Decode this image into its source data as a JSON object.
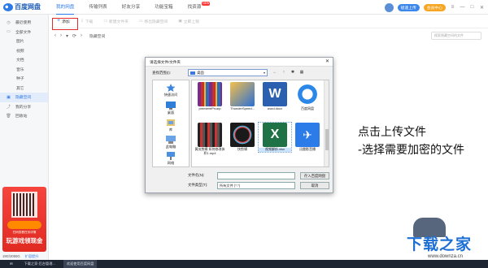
{
  "app": {
    "name": "百度网盘"
  },
  "nav": [
    "我的网盘",
    "传输列表",
    "好友分享",
    "功能宝箱",
    "找资源"
  ],
  "nav_badge": "NEW",
  "top_right": {
    "upload_label": "极速上传",
    "vip_label": "会员中心"
  },
  "sidebar": [
    {
      "label": "最近使用",
      "icon": "clock-icon"
    },
    {
      "label": "全部文件",
      "icon": "folder-icon"
    },
    {
      "label": "图片",
      "sub": true
    },
    {
      "label": "视频",
      "sub": true
    },
    {
      "label": "文档",
      "sub": true
    },
    {
      "label": "音乐",
      "sub": true
    },
    {
      "label": "种子",
      "sub": true
    },
    {
      "label": "其它",
      "sub": true
    },
    {
      "label": "隐藏空间",
      "icon": "lock-icon",
      "active": true
    },
    {
      "label": "我的分享",
      "icon": "share-icon"
    },
    {
      "label": "回收站",
      "icon": "trash-icon"
    }
  ],
  "ad": {
    "subtitle": "扫码查看任务详情",
    "title": "玩游戏领现金"
  },
  "quota": {
    "text": "19G/2055G",
    "expand": "扩容提升"
  },
  "toolbar": {
    "add": "添加",
    "download": "下载",
    "new_folder": "新建文件夹",
    "remove": "移出隐藏空间",
    "lock": "立即上锁"
  },
  "path": {
    "current": "隐藏空间",
    "search_placeholder": "搜索隐藏空间的文件"
  },
  "dialog": {
    "title": "请选择文件/文件夹",
    "look_in_label": "查找范围(I):",
    "look_in_value": "桌面",
    "places": [
      {
        "label": "快速访问",
        "icon": "star-icon"
      },
      {
        "label": "桌面",
        "icon": "desktop-icon"
      },
      {
        "label": "库",
        "icon": "library-icon"
      },
      {
        "label": "此电脑",
        "icon": "computer-icon"
      },
      {
        "label": "网络",
        "icon": "network-icon"
      }
    ],
    "files": [
      {
        "name": "premiereProzip",
        "kind": "rar"
      },
      {
        "name": "ThunderSpeed...",
        "kind": "thunder"
      },
      {
        "name": "word.docx",
        "kind": "word"
      },
      {
        "name": "百度网盘",
        "kind": "baidu"
      },
      {
        "name": "黄瓜剪辑 如何修改体积1.mp4",
        "kind": "video"
      },
      {
        "name": "快剪辑",
        "kind": "kuaijian"
      },
      {
        "name": "视频解析.xlsx",
        "kind": "excel",
        "selected": true
      },
      {
        "name": "迅雷影音播",
        "kind": "xunlei"
      }
    ],
    "filename_label": "文件名(N):",
    "filename_value": "",
    "filetype_label": "文件类型(T):",
    "filetype_value": "所有文件 (*.*)",
    "save_button": "存入百度网盘",
    "cancel_button": "取消"
  },
  "annotation": [
    "点击上传文件",
    "-选择需要加密的文件"
  ],
  "watermark": {
    "title": "下载之家",
    "url": "www.downza.cn"
  },
  "taskbar": [
    {
      "label": "下载之家-后台管理..."
    },
    {
      "label": "欢迎使用百度网盘",
      "active": true
    }
  ],
  "colors": {
    "accent": "#2d7ae6",
    "highlight_box": "#e52b2b",
    "vip": "#f6a623"
  }
}
